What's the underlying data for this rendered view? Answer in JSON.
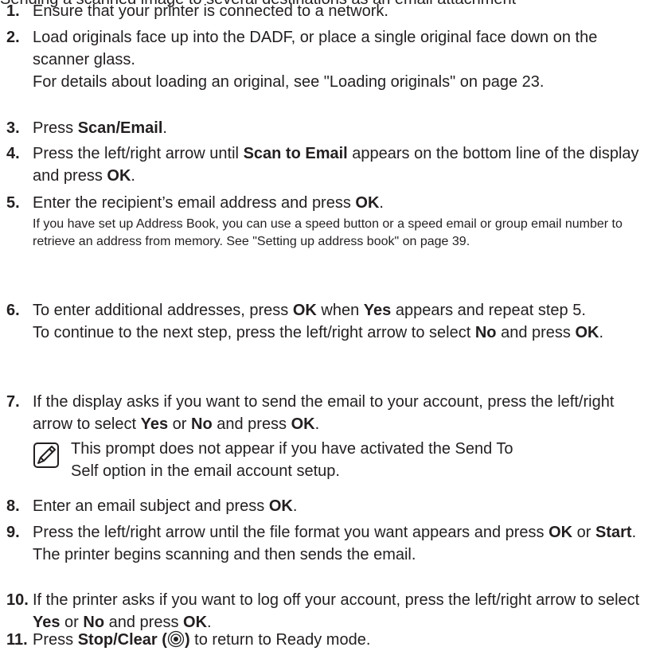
{
  "cut_line": "Sending a scanned image to several destinations as an email attachment",
  "steps": [
    {
      "num": "1.",
      "text": "Ensure that your printer is connected to a network."
    },
    {
      "num": "2.",
      "line1": "Load originals face up into the DADF, or place a single original face down on the scanner glass.",
      "line2": "For details about loading an original, see \"Loading originals\" on page 23."
    },
    {
      "num": "3.",
      "pre": "Press ",
      "bold": "Scan/Email",
      "post": "."
    },
    {
      "num": "4.",
      "pre": "Press the left/right arrow until ",
      "bold1": "Scan to Email",
      "mid": " appears on the bottom line of the display and press ",
      "bold2": "OK",
      "post": "."
    },
    {
      "num": "5.",
      "pre": "Enter the recipient’s email address and press ",
      "bold": "OK",
      "post": ".",
      "small": "If you have set up Address Book, you can use a speed button or a speed email or group email number to retrieve an address from memory. See \"Setting up address book\" on page 39."
    },
    {
      "num": "6.",
      "pre": "To enter additional addresses, press ",
      "bold1": "OK",
      "mid": " when ",
      "bold2": "Yes",
      "post": " appears and repeat step 5.",
      "pre2": "To continue to the next step, press the left/right arrow to select ",
      "bold3": "No",
      "mid2": " and press ",
      "bold4": "OK",
      "post2": "."
    },
    {
      "num": "7.",
      "pre": "If the display asks if you want to send the email to your account, press the left/right arrow to select ",
      "bold1": "Yes",
      "mid1": " or ",
      "bold2": "No",
      "mid2": " and press ",
      "bold3": "OK",
      "post": ".",
      "note": "This prompt does not appear if you have activated the Send To Self option in the email account setup."
    },
    {
      "num": "8.",
      "pre": "Enter an email subject and press ",
      "bold": "OK",
      "post": "."
    },
    {
      "num": "9.",
      "pre": "Press the left/right arrow until the file format you want appears and press ",
      "bold1": "OK",
      "mid": " or ",
      "bold2": "Start",
      "post": ".",
      "line2": "The printer begins scanning and then sends the email."
    },
    {
      "num": "10.",
      "pre": "If the printer asks if you want to log off your account, press the left/right arrow to select ",
      "bold1": "Yes",
      "mid1": " or ",
      "bold2": "No",
      "mid2": " and press ",
      "bold3": "OK",
      "post": "."
    },
    {
      "num": "11.",
      "pre": "Press ",
      "bold": "Stop/Clear (",
      "bold_close": ")",
      "post": " to return to Ready mode."
    }
  ]
}
